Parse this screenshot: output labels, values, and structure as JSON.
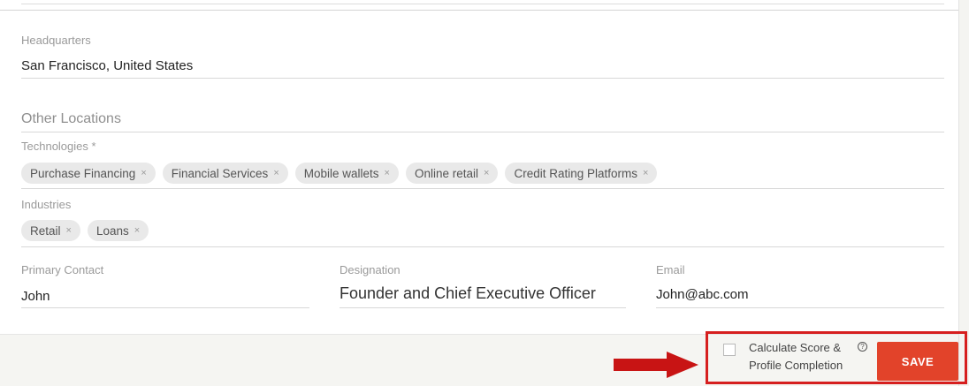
{
  "headquarters": {
    "label": "Headquarters",
    "value": "San Francisco, United States"
  },
  "other_locations": {
    "placeholder": "Other Locations"
  },
  "technologies": {
    "label": "Technologies *",
    "chips": [
      "Purchase Financing",
      "Financial Services",
      "Mobile wallets",
      "Online retail",
      "Credit Rating Platforms"
    ],
    "remove_glyph": "×"
  },
  "industries": {
    "label": "Industries",
    "chips": [
      "Retail",
      "Loans"
    ],
    "remove_glyph": "×"
  },
  "primary_contact": {
    "label": "Primary Contact",
    "value": "John"
  },
  "designation": {
    "label": "Designation",
    "value": "Founder and Chief Executive Officer"
  },
  "email": {
    "label": "Email",
    "value": "John@abc.com"
  },
  "footer": {
    "calculate_label": "Calculate Score & Profile Completion",
    "calculate_checked": false,
    "help_icon": "?",
    "save_label": "SAVE"
  },
  "colors": {
    "save_button": "#e2432a",
    "highlight": "#d61f1f",
    "arrow": "#c81414"
  },
  "icons": {
    "chip_remove": "close-icon",
    "help": "help-icon",
    "arrow": "arrow-right-icon"
  }
}
